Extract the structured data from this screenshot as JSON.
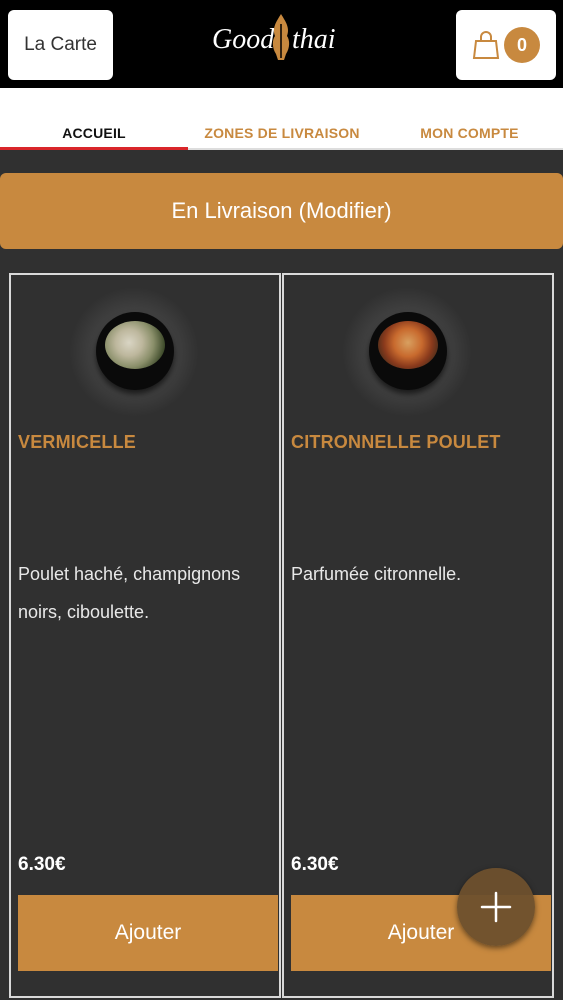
{
  "header": {
    "menu_label": "La Carte",
    "logo_text": "Good Thai",
    "cart_count": "0"
  },
  "tabs": [
    {
      "label": "ACCUEIL"
    },
    {
      "label": "ZONES DE LIVRAISON"
    },
    {
      "label": "MON COMPTE"
    }
  ],
  "delivery": {
    "label": "En Livraison (Modifier)"
  },
  "products": [
    {
      "name": "VERMICELLE",
      "description": "Poulet haché, champignons noirs, ciboulette.",
      "price": "6.30€",
      "button": "Ajouter"
    },
    {
      "name": "CITRONNELLE POULET",
      "description": "Parfumée citronnelle.",
      "price": "6.30€",
      "button": "Ajouter"
    }
  ],
  "colors": {
    "accent": "#c8893f",
    "active_tab_underline": "#d9262a",
    "background": "#303030"
  },
  "icons": {
    "cart": "shopping-bag-icon",
    "fab": "plus-icon"
  }
}
